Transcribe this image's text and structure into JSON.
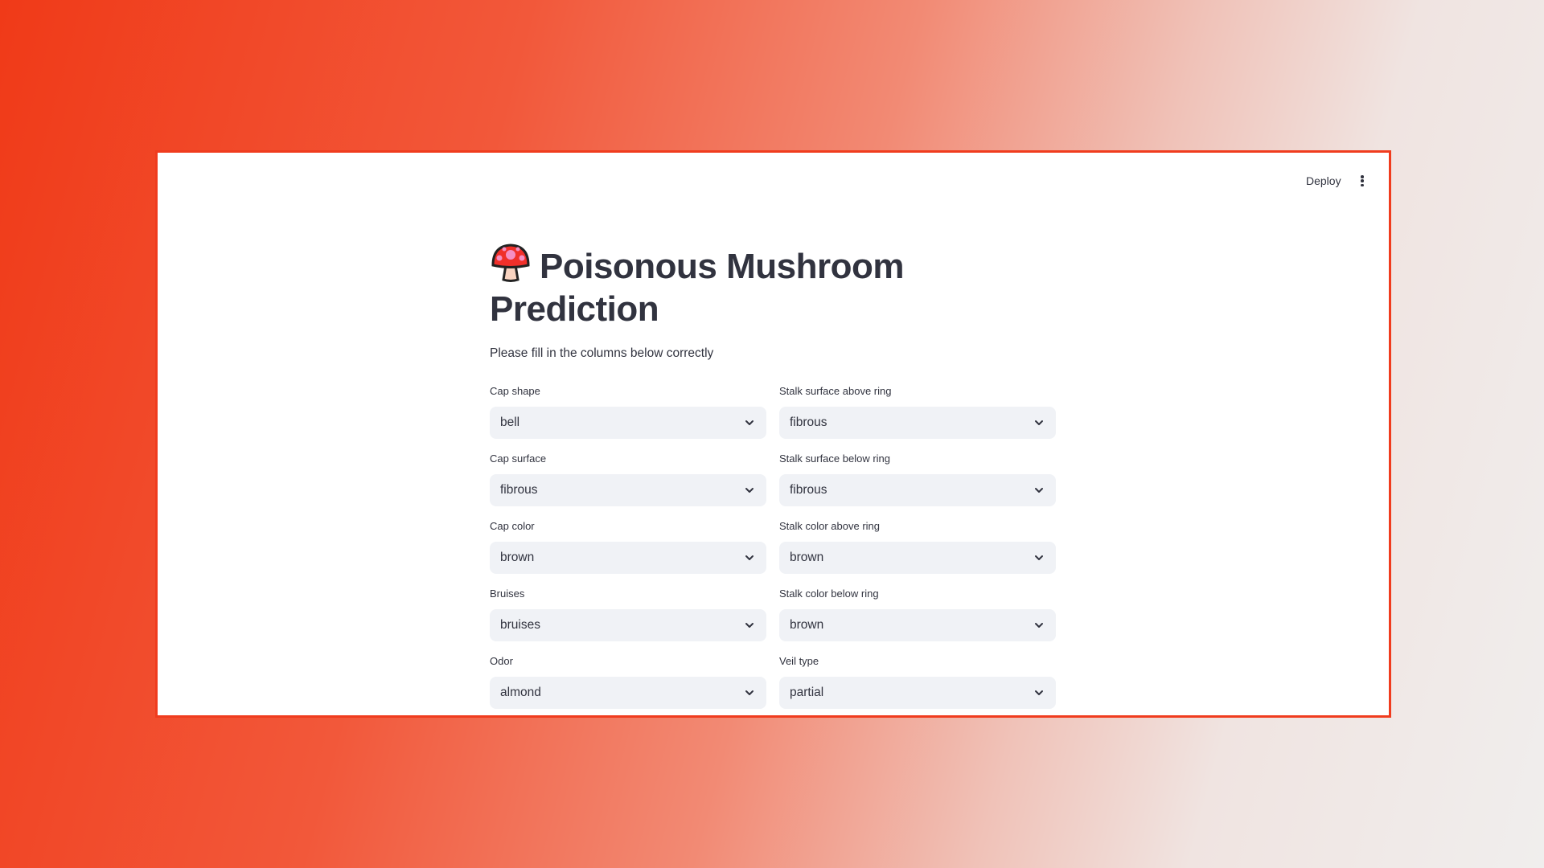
{
  "header": {
    "deploy_label": "Deploy"
  },
  "page": {
    "title": "Poisonous Mushroom Prediction",
    "subtitle": "Please fill in the columns below correctly"
  },
  "left_fields": [
    {
      "label": "Cap shape",
      "value": "bell"
    },
    {
      "label": "Cap surface",
      "value": "fibrous"
    },
    {
      "label": "Cap color",
      "value": "brown"
    },
    {
      "label": "Bruises",
      "value": "bruises"
    },
    {
      "label": "Odor",
      "value": "almond"
    }
  ],
  "right_fields": [
    {
      "label": "Stalk surface above ring",
      "value": "fibrous"
    },
    {
      "label": "Stalk surface below ring",
      "value": "fibrous"
    },
    {
      "label": "Stalk color above ring",
      "value": "brown"
    },
    {
      "label": "Stalk color below ring",
      "value": "brown"
    },
    {
      "label": "Veil type",
      "value": "partial"
    }
  ],
  "colors": {
    "frame": "#f03c1e",
    "select_bg": "#f0f2f6",
    "text": "#31333f"
  }
}
